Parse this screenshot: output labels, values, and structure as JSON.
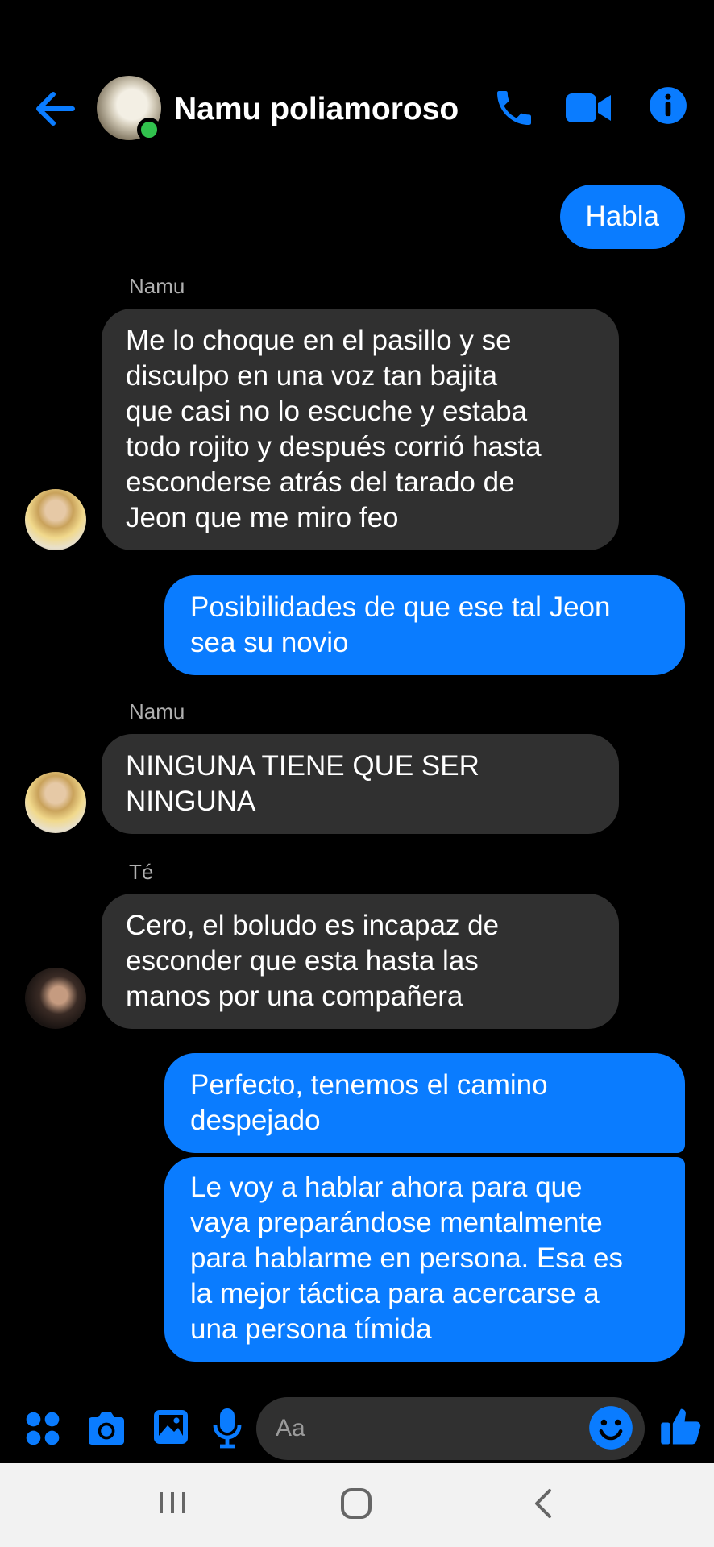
{
  "header": {
    "contact_name": "Namu poliamoroso",
    "icons": [
      "back-arrow-icon",
      "phone-icon",
      "video-camera-icon",
      "info-icon"
    ],
    "accent_color": "#0a7cff",
    "online_color": "#31c24d"
  },
  "messages": [
    {
      "direction": "sent",
      "text": "Habla"
    },
    {
      "direction": "received",
      "sender": "Namu",
      "text": "Me lo choque en el pasillo y se\ndisculpo en una voz tan bajita\nque casi no lo escuche y estaba\ntodo rojito y después corrió hasta\nesconderse atrás del tarado de\nJeon que me miro feo"
    },
    {
      "direction": "sent",
      "text": "Posibilidades de que ese tal Jeon\nsea su novio"
    },
    {
      "direction": "received",
      "sender": "Namu",
      "text": "NINGUNA TIENE QUE SER\nNINGUNA"
    },
    {
      "direction": "received",
      "sender": "Té",
      "text": "Cero, el boludo es incapaz de\nesconder que esta hasta las\nmanos por una compañera"
    },
    {
      "direction": "sent",
      "text": "Perfecto, tenemos el camino\ndespejado"
    },
    {
      "direction": "sent",
      "text": "Le voy a hablar ahora para que\nvaya preparándose mentalmente\npara hablarme en persona. Esa es\nla mejor táctica para acercarse a\nuna persona tímida"
    }
  ],
  "composer": {
    "placeholder": "Aa",
    "icons": [
      "apps-grid-icon",
      "camera-icon",
      "gallery-icon",
      "microphone-icon",
      "emoji-icon",
      "thumbs-up-icon"
    ]
  },
  "navbar": {
    "icons": [
      "recent-apps-icon",
      "home-icon",
      "back-icon"
    ]
  }
}
